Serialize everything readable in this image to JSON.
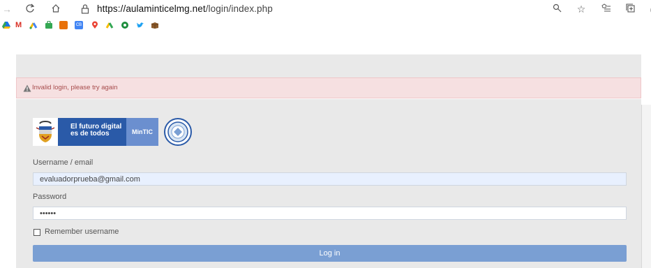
{
  "browser": {
    "url_host": "https://aulaminticelmg.net",
    "url_path": "/login/index.php",
    "bookmark_icons": [
      "google-drive",
      "gmail",
      "google-ads",
      "google-shopping",
      "zoho",
      "ce-icon",
      "google-maps",
      "google-ads-2",
      "quick-icon",
      "twitter",
      "box-icon"
    ],
    "bookmark_colors": [
      "#1a73e8",
      "#d93025",
      "#fbbc04",
      "#34a853",
      "#e8710a",
      "#4285f4",
      "#ea4335",
      "#34a853",
      "#1e8e3e",
      "#1da1f2",
      "#8b5a2b"
    ]
  },
  "alert": {
    "message": "Invalid login, please try again"
  },
  "logos": {
    "line1": "El futuro digital",
    "line2": "es de todos",
    "brand": "MinTIC"
  },
  "form": {
    "username_label": "Username / email",
    "username_value": "evaluadorprueba@gmail.com",
    "password_label": "Password",
    "password_value": "••••••",
    "remember_label": "Remember username",
    "login_label": "Log in"
  },
  "colors": {
    "accent": "#7a9fd3",
    "alert_bg": "#f6e0e1",
    "alert_text": "#a64b4b"
  }
}
